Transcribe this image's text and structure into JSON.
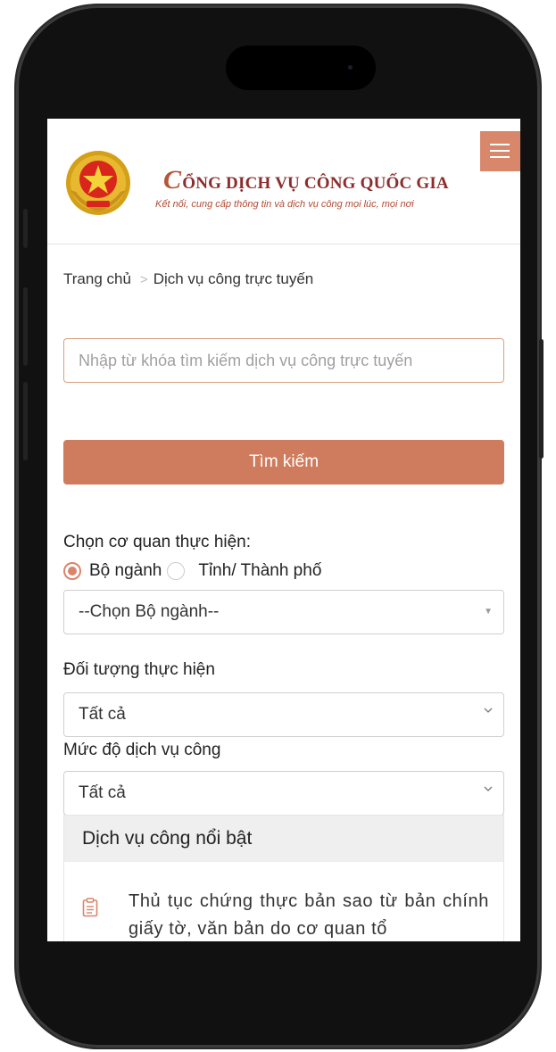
{
  "header": {
    "site_title_initial": "C",
    "site_title_rest": "ỔNG DỊCH VỤ CÔNG QUỐC GIA",
    "site_subtitle": "Kết nối, cung cấp thông tin và dịch vụ công mọi lúc, mọi nơi",
    "emblem_icon": "national-emblem-icon",
    "menu_icon": "hamburger-menu-icon"
  },
  "breadcrumb": {
    "home": "Trang chủ",
    "separator": ">",
    "current": "Dịch vụ công trực tuyến"
  },
  "search": {
    "placeholder": "Nhập từ khóa tìm kiếm dịch vụ công trực tuyến",
    "button_label": "Tìm kiếm"
  },
  "agency": {
    "label": "Chọn cơ quan thực hiện:",
    "options": [
      {
        "label": "Bộ ngành",
        "checked": true
      },
      {
        "label": "Tỉnh/ Thành phố",
        "checked": false
      }
    ],
    "select_value": "--Chọn Bộ ngành--"
  },
  "subject": {
    "label": "Đối tượng thực hiện",
    "select_value": "Tất cả"
  },
  "level": {
    "label": "Mức độ dịch vụ công",
    "select_value": "Tất cả"
  },
  "featured": {
    "heading": "Dịch vụ công nổi bật",
    "items": [
      {
        "text": "Thủ tục chứng thực bản sao từ bản chính giấy tờ, văn bản do cơ quan tổ",
        "icon": "document-icon"
      }
    ]
  },
  "colors": {
    "accent": "#cf7b5d",
    "title": "#8c2c2c",
    "subtitle": "#b24a32"
  }
}
